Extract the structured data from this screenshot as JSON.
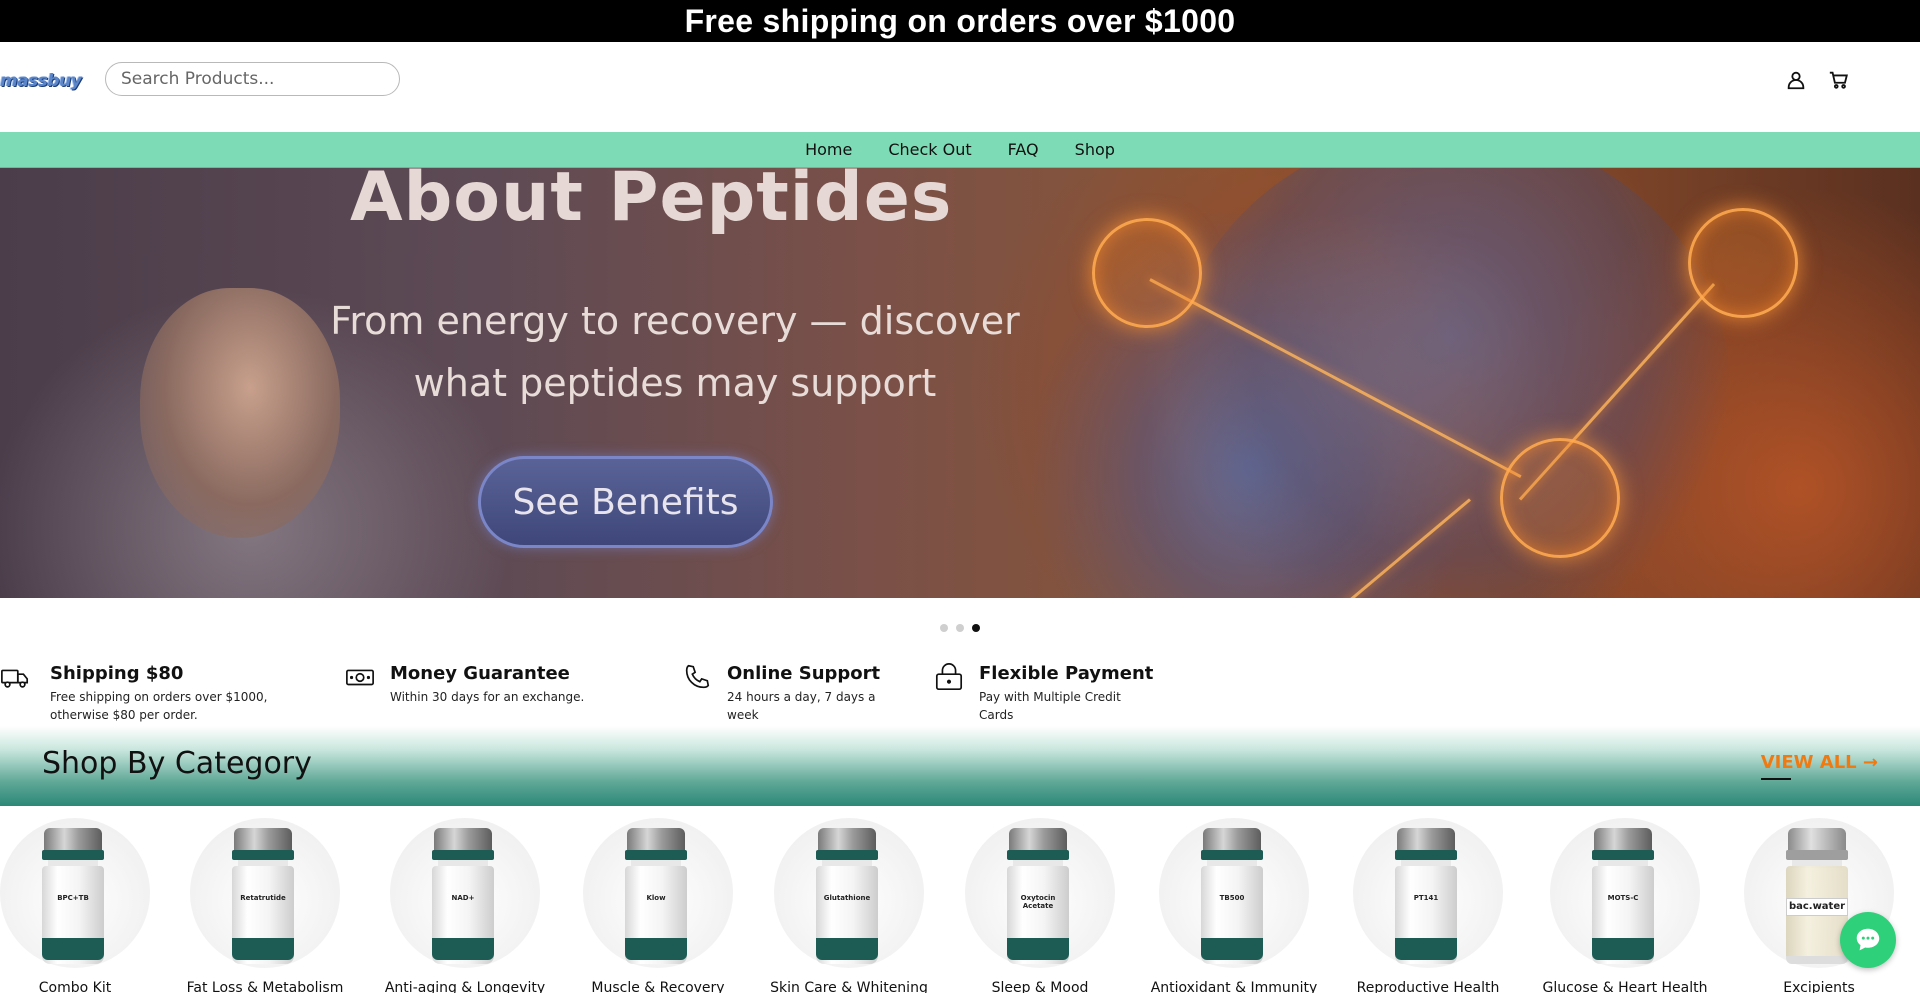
{
  "announcement": "Free shipping on orders over $1000",
  "header": {
    "logo_text": "massbuy",
    "search_placeholder": "Search Products..."
  },
  "nav": {
    "items": [
      "Home",
      "Check Out",
      "FAQ",
      "Shop"
    ]
  },
  "hero": {
    "title": "About Peptides",
    "subtitle": "From energy to recovery — discover what peptides may support",
    "button_label": "See Benefits",
    "slide_count": 3,
    "active_slide": 3
  },
  "features": [
    {
      "icon": "truck-icon",
      "title": "Shipping $80",
      "desc": "Free shipping on orders over $1000, otherwise $80 per order."
    },
    {
      "icon": "money-icon",
      "title": "Money Guarantee",
      "desc": "Within 30 days for an exchange."
    },
    {
      "icon": "phone-icon",
      "title": "Online Support",
      "desc": "24 hours a day, 7 days a week"
    },
    {
      "icon": "lock-icon",
      "title": "Flexible Payment",
      "desc": "Pay with Multiple Credit Cards"
    }
  ],
  "category_section": {
    "title": "Shop By Category",
    "view_all": "VIEW ALL →",
    "accent_color": "#f07a12"
  },
  "categories": [
    {
      "name": "Combo Kit",
      "vial_label": "BPC+TB"
    },
    {
      "name": "Fat Loss & Metabolism",
      "vial_label": "Retatrutide"
    },
    {
      "name": "Anti-aging & Longevity",
      "vial_label": "NAD+"
    },
    {
      "name": "Muscle & Recovery",
      "vial_label": "Klow"
    },
    {
      "name": "Skin Care & Whitening",
      "vial_label": "Glutathione"
    },
    {
      "name": "Sleep & Mood",
      "vial_label": "Oxytocin Acetate"
    },
    {
      "name": "Antioxidant & Immunity",
      "vial_label": "TB500"
    },
    {
      "name": "Reproductive Health",
      "vial_label": "PT141"
    },
    {
      "name": "Glucose & Heart Health",
      "vial_label": "MOTS-C"
    },
    {
      "name": "Excipients",
      "vial_label": "bac.water"
    }
  ],
  "colors": {
    "nav_bg": "#7ddcb6",
    "brand_green": "#1d5c55",
    "chat_bg": "#2fd07a"
  }
}
